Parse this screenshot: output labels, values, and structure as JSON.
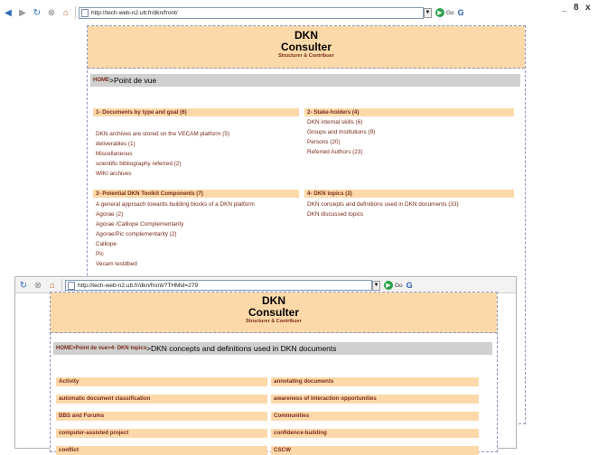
{
  "back_window": {
    "url": "http://tech-web-n2.utt.fr/dkn/front/",
    "go_label": "Go",
    "window_controls": {
      "minimize": "_",
      "maximize": "8",
      "close": "x"
    },
    "header": {
      "title_line1": "DKN",
      "title_line2": "Consulter",
      "subtitle": "Structurer & Contribuer"
    },
    "breadcrumb": {
      "home": "HOME",
      "current": ">Point de vue"
    },
    "sections": [
      {
        "title": "1- Documents by type and goal (6)",
        "items": [
          "DKN archives are stored on the VECAM platform (5)",
          "deliverables (1)",
          "Miscellaneous",
          "scientific bibliography referred (2)",
          "WIKI archives"
        ]
      },
      {
        "title": "2- Stake-holders (4)",
        "items": [
          "DKN internal skills (6)",
          "Groups and Institutions (9)",
          "Persons (20)",
          "Referred Authors (23)"
        ]
      },
      {
        "title": "3- Potential DKN Toolkit Components (7)",
        "items": [
          "A general approach towards building blocks of a DKN platform",
          "Agorae (2)",
          "Agorae /Calliope Complementarity",
          "Agorae/Pic complementarity (2)",
          "Calliope",
          "Pic",
          "Vecam testdbed"
        ]
      },
      {
        "title": "4- DKN topics (2)",
        "items": [
          "DKN concepts and definitions used in DKN documents (33)",
          "DKN discussed  topics"
        ]
      }
    ]
  },
  "front_window": {
    "url": "http://tech-web-n2.utt.fr/dkn/front/?THMid=279",
    "go_label": "Go",
    "header": {
      "title_line1": "DKN",
      "title_line2": "Consulter",
      "subtitle": "Structurer & Contribuer"
    },
    "breadcrumb": {
      "home": "HOME",
      "part1": ">Point de vue",
      "part2": ">4- DKN topics",
      "current": ">DKN concepts and definitions used in DKN documents"
    },
    "concepts": [
      [
        "Activity",
        "annotating documents"
      ],
      [
        "automatic document classification",
        "awareness of interaction opportunities"
      ],
      [
        "BBS and Forums",
        "Communities"
      ],
      [
        "computer-assisted project",
        "confidence-building"
      ],
      [
        "conflict",
        "CSCW"
      ]
    ]
  },
  "colors": {
    "header_bg": "#fdd9a9",
    "link": "#7a2a1a",
    "crumb_bg": "#d0d0d0",
    "border": "#8a94c0"
  }
}
